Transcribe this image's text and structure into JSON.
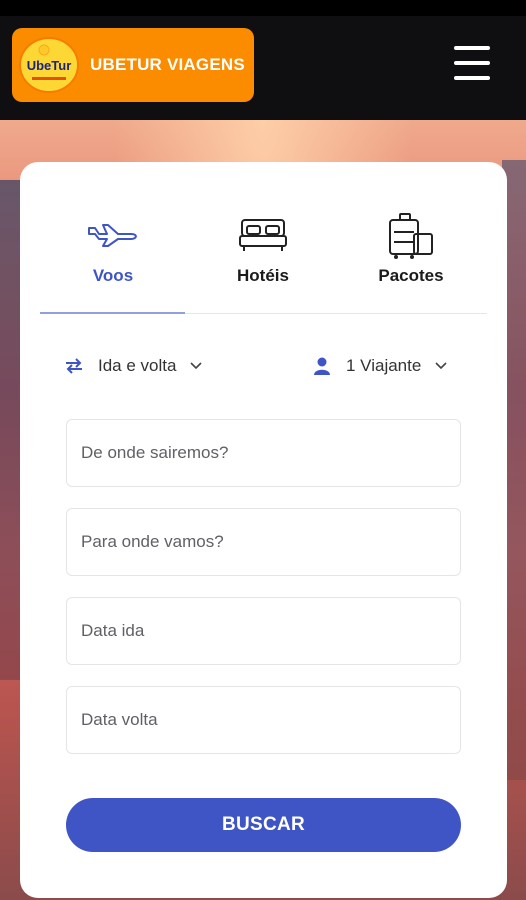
{
  "header": {
    "brand_title": "UBETUR VIAGENS",
    "logo_text": "UbeTur",
    "menu_icon": "hamburger-menu-icon"
  },
  "tabs": [
    {
      "label": "Voos",
      "icon": "airplane-icon",
      "active": true
    },
    {
      "label": "Hotéis",
      "icon": "bed-icon",
      "active": false
    },
    {
      "label": "Pacotes",
      "icon": "luggage-icon",
      "active": false
    }
  ],
  "options": {
    "trip_type": "Ida e volta",
    "travelers": "1 Viajante"
  },
  "fields": {
    "origin_placeholder": "De onde sairemos?",
    "destination_placeholder": "Para onde vamos?",
    "depart_placeholder": "Data ida",
    "return_placeholder": "Data volta"
  },
  "search_label": "BUSCAR",
  "colors": {
    "brand_orange": "#fb8c00",
    "primary_blue": "#3f55c5",
    "header_bg": "#0f0f11"
  }
}
